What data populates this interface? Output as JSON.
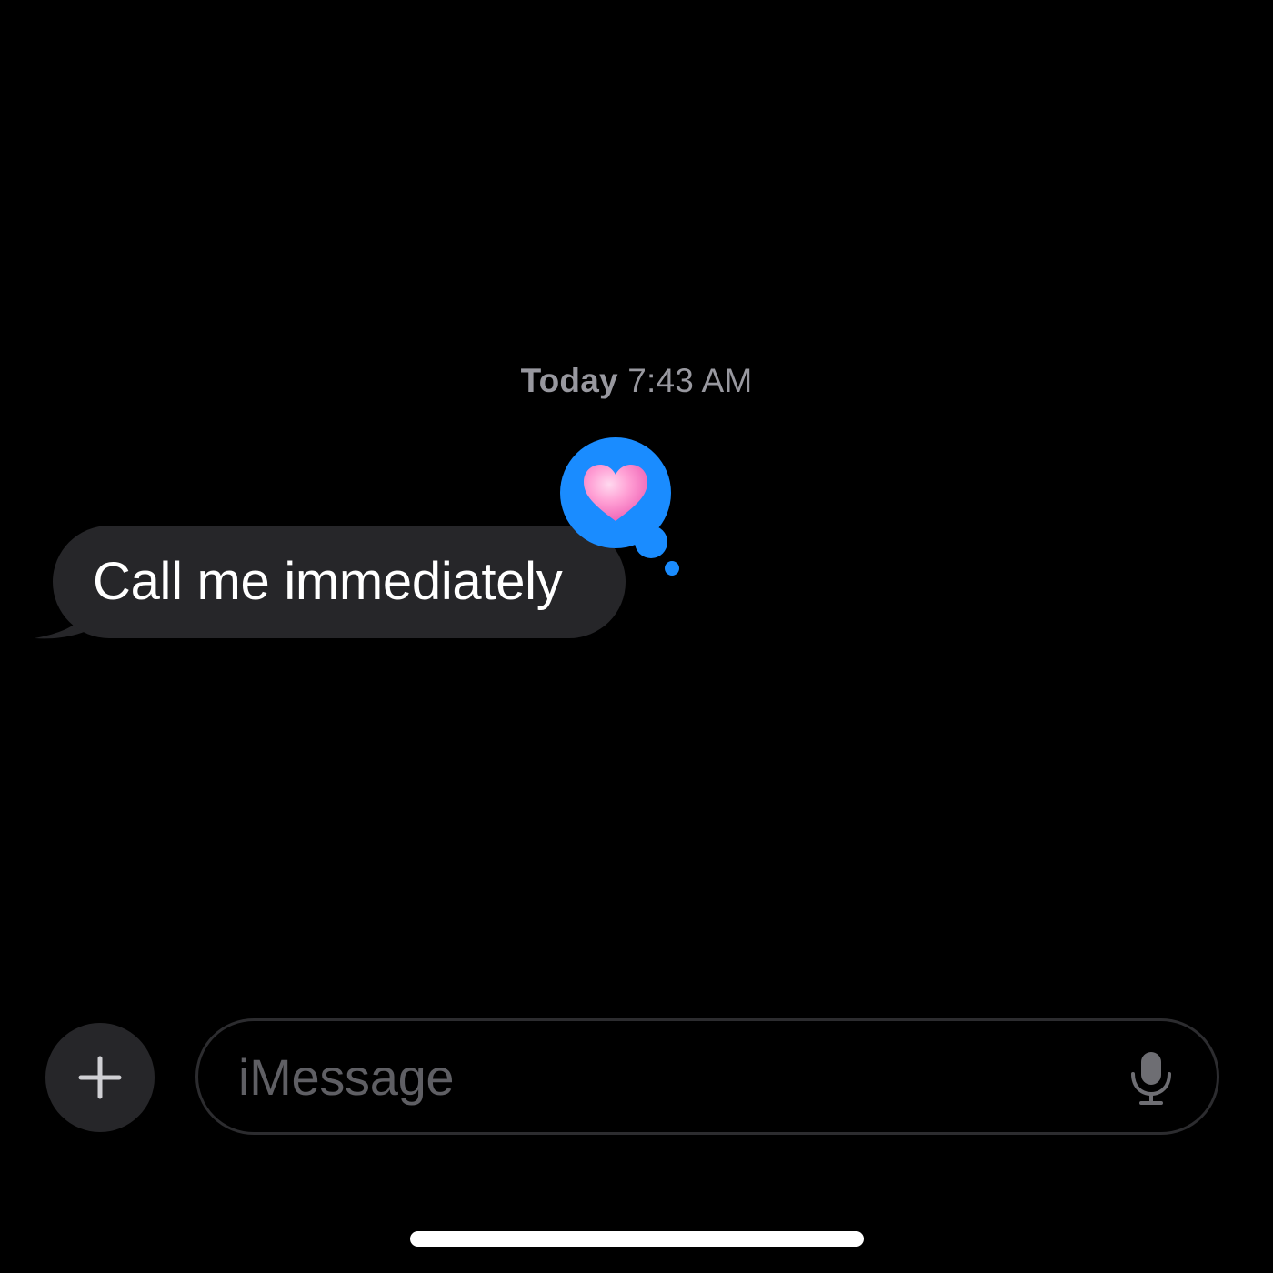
{
  "timestamp": {
    "day": "Today",
    "time": "7:43 AM"
  },
  "message": {
    "text": "Call me immediately",
    "direction": "incoming",
    "bubble_color": "#262629",
    "text_color": "#ffffff"
  },
  "tapback": {
    "reaction": "heart",
    "icon": "pink-heart-icon",
    "badge_color": "#1a8cff"
  },
  "compose": {
    "add_icon": "plus-icon",
    "placeholder": "iMessage",
    "mic_icon": "microphone-icon"
  },
  "colors": {
    "background": "#000000",
    "timestamp": "#98989f",
    "placeholder": "#5f5f64",
    "accent": "#1a8cff"
  }
}
